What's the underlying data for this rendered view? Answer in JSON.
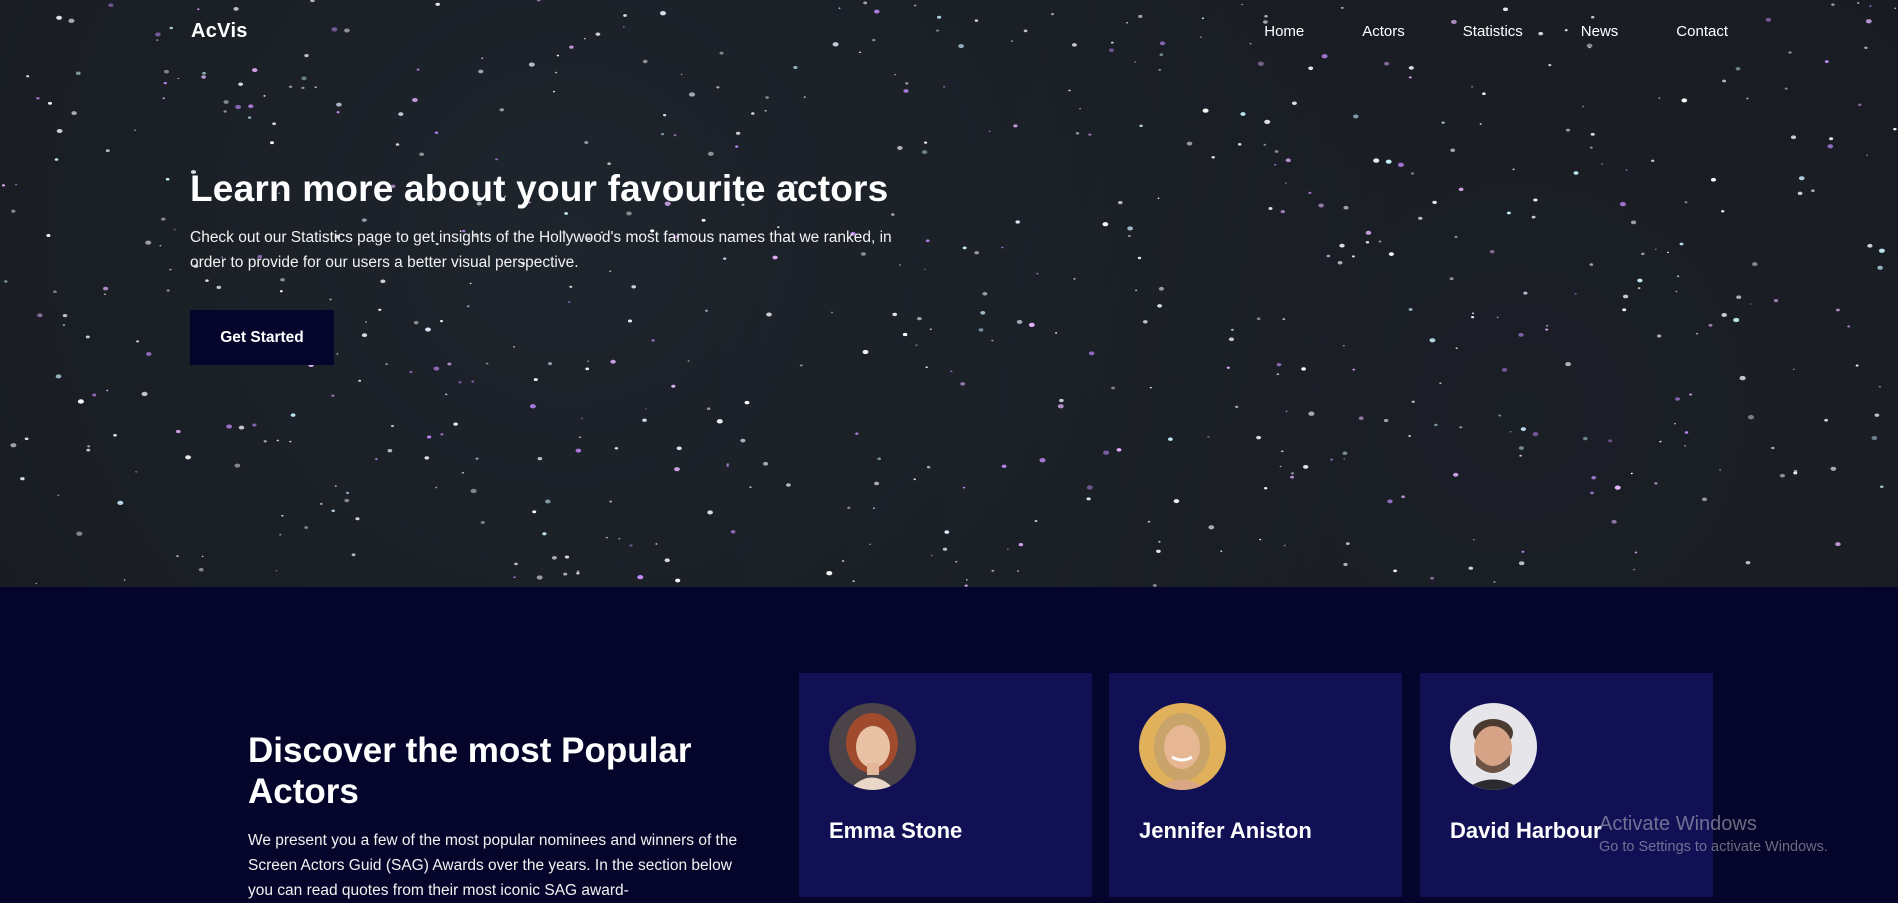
{
  "header": {
    "brand": "AcVis",
    "nav": [
      "Home",
      "Actors",
      "Statistics",
      "News",
      "Contact"
    ]
  },
  "hero": {
    "title": "Learn more about your favourite actors",
    "text": "Check out our Statistics page to get insights of the Hollywood's most famous names that we ranked, in order to provide for our users a better visual perspective.",
    "button": "Get Started"
  },
  "popular": {
    "title": "Discover the most Popular Actors",
    "text": "We present you a few of the most popular nominees and winners of the Screen Actors Guid (SAG) Awards over the years. In the section below you can read quotes from their most iconic SAG award-",
    "actors": [
      "Emma Stone",
      "Jennifer Aniston",
      "David Harbour"
    ]
  },
  "watermark": {
    "title": "Activate Windows",
    "subtitle": "Go to Settings to activate Windows."
  },
  "colors": {
    "hero_bg": "#171a20",
    "section_bg": "#05052b",
    "card_bg": "#121055",
    "button_bg": "#05052b",
    "text": "#ffffff"
  }
}
